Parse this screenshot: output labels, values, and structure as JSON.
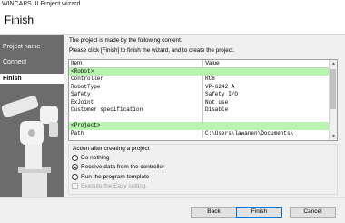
{
  "window": {
    "title": "WINCAPS III Project wizard"
  },
  "header": {
    "title": "Finish"
  },
  "sidebar": {
    "items": [
      {
        "label": "Project name",
        "active": false
      },
      {
        "label": "Connect",
        "active": false
      },
      {
        "label": "Finish",
        "active": true
      }
    ]
  },
  "main": {
    "description_line1": "The project is made by the following content.",
    "description_line2": "Please click [Finish] to finish the wizard, and to create the project."
  },
  "grid": {
    "columns": [
      "Item",
      "Value"
    ],
    "rows": [
      {
        "item": "<Robot>",
        "value": "",
        "section": true
      },
      {
        "item": "Controller",
        "value": "RC8",
        "section": false
      },
      {
        "item": "RobotType",
        "value": "VP-6242 A",
        "section": false
      },
      {
        "item": "Safety",
        "value": "Safety I/O",
        "section": false
      },
      {
        "item": "ExJoint",
        "value": "Not use",
        "section": false
      },
      {
        "item": "Customer specification",
        "value": "Disable",
        "section": false
      },
      {
        "item": "",
        "value": "",
        "section": false
      },
      {
        "item": "<Project>",
        "value": "",
        "section": true
      },
      {
        "item": "Path",
        "value": "C:\\Users\\lawanen\\Documents\\",
        "section": false
      }
    ]
  },
  "action_group": {
    "title": "Action after creating a project",
    "options": [
      {
        "label": "Do nothing",
        "selected": false
      },
      {
        "label": "Receive data from the controller",
        "selected": true
      },
      {
        "label": "Run the program template",
        "selected": false
      }
    ],
    "checkbox": {
      "label": "Execute the Easy setting.",
      "checked": false,
      "enabled": false
    }
  },
  "buttons": {
    "back": "Back",
    "finish": "Finish",
    "cancel": "Cancel"
  },
  "colors": {
    "section_row": "#b9f5b0",
    "sidebar": "#6c6c6c",
    "focus_border": "#0078d7"
  }
}
